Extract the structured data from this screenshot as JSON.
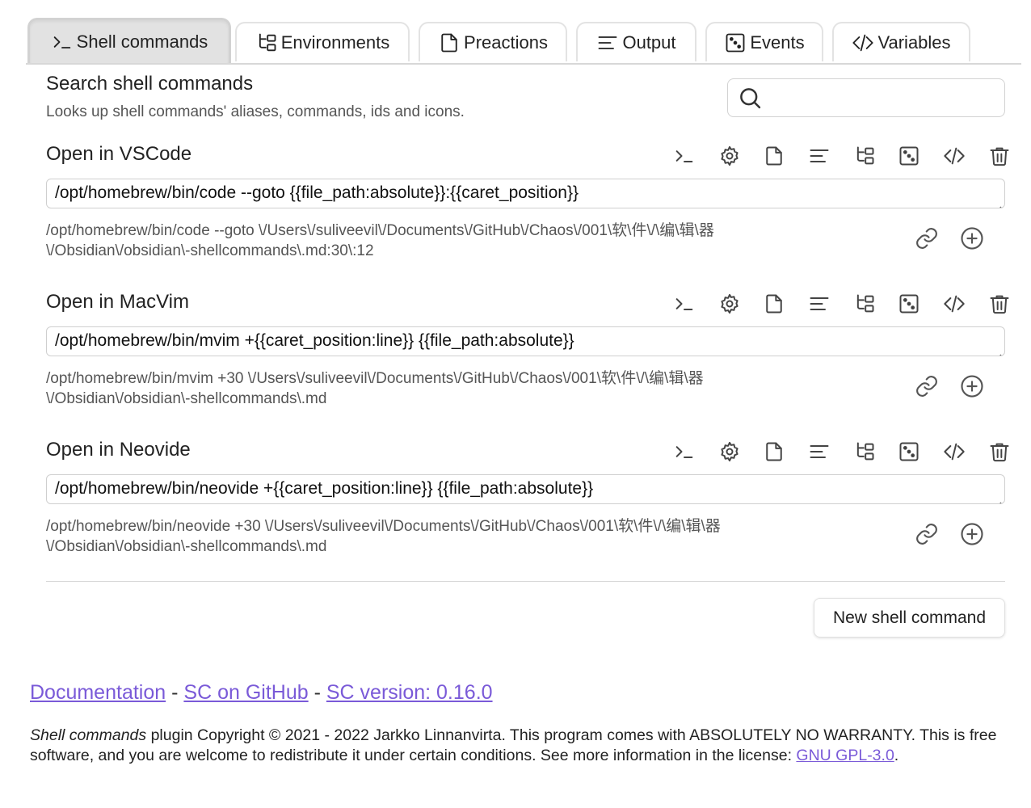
{
  "tabs": [
    {
      "label": "Shell commands",
      "icon": "terminal-icon",
      "active": true
    },
    {
      "label": "Environments",
      "icon": "tree-icon",
      "active": false
    },
    {
      "label": "Preactions",
      "icon": "file-icon",
      "active": false
    },
    {
      "label": "Output",
      "icon": "align-left-icon",
      "active": false
    },
    {
      "label": "Events",
      "icon": "dice-icon",
      "active": false
    },
    {
      "label": "Variables",
      "icon": "code-icon",
      "active": false
    }
  ],
  "search": {
    "title": "Search shell commands",
    "description": "Looks up shell commands' aliases, commands, ids and icons.",
    "value": "",
    "placeholder": ""
  },
  "commands": [
    {
      "name": "Open in VSCode",
      "command": "/opt/homebrew/bin/code --goto {{file_path:absolute}}:{{caret_position}}",
      "preview_line1": "/opt/homebrew/bin/code --goto \\/Users\\/suliveevil\\/Documents\\/GitHub\\/Chaos\\/001\\软\\件\\/\\编\\辑\\器",
      "preview_line2": "\\/Obsidian\\/obsidian\\-shellcommands\\.md:30\\:12"
    },
    {
      "name": "Open in MacVim",
      "command": "/opt/homebrew/bin/mvim +{{caret_position:line}} {{file_path:absolute}}",
      "preview_line1": "/opt/homebrew/bin/mvim +30 \\/Users\\/suliveevil\\/Documents\\/GitHub\\/Chaos\\/001\\软\\件\\/\\编\\辑\\器",
      "preview_line2": "\\/Obsidian\\/obsidian\\-shellcommands\\.md"
    },
    {
      "name": "Open in Neovide",
      "command": "/opt/homebrew/bin/neovide +{{caret_position:line}} {{file_path:absolute}}",
      "preview_line1": "/opt/homebrew/bin/neovide +30 \\/Users\\/suliveevil\\/Documents\\/GitHub\\/Chaos\\/001\\软\\件\\/\\编\\辑\\器",
      "preview_line2": "\\/Obsidian\\/obsidian\\-shellcommands\\.md"
    }
  ],
  "command_action_icons": [
    "terminal-icon",
    "gear-icon",
    "file-icon",
    "align-left-icon",
    "tree-icon",
    "dice-icon",
    "code-icon",
    "trash-icon"
  ],
  "new_command_label": "New shell command",
  "footer": {
    "link_documentation": "Documentation",
    "separator": "-",
    "link_github": "SC on GitHub",
    "link_version": "SC version: 0.16.0",
    "license_italic": "Shell commands",
    "license_text": " plugin Copyright © 2021 - 2022 Jarkko Linnanvirta. This program comes with ABSOLUTELY NO WARRANTY. This is free software, and you are welcome to redistribute it under certain conditions. See more information in the license: ",
    "license_link": "GNU GPL-3.0",
    "license_end": "."
  },
  "colors": {
    "link": "#7a5ad8",
    "active_tab": "#e2e2e2"
  }
}
